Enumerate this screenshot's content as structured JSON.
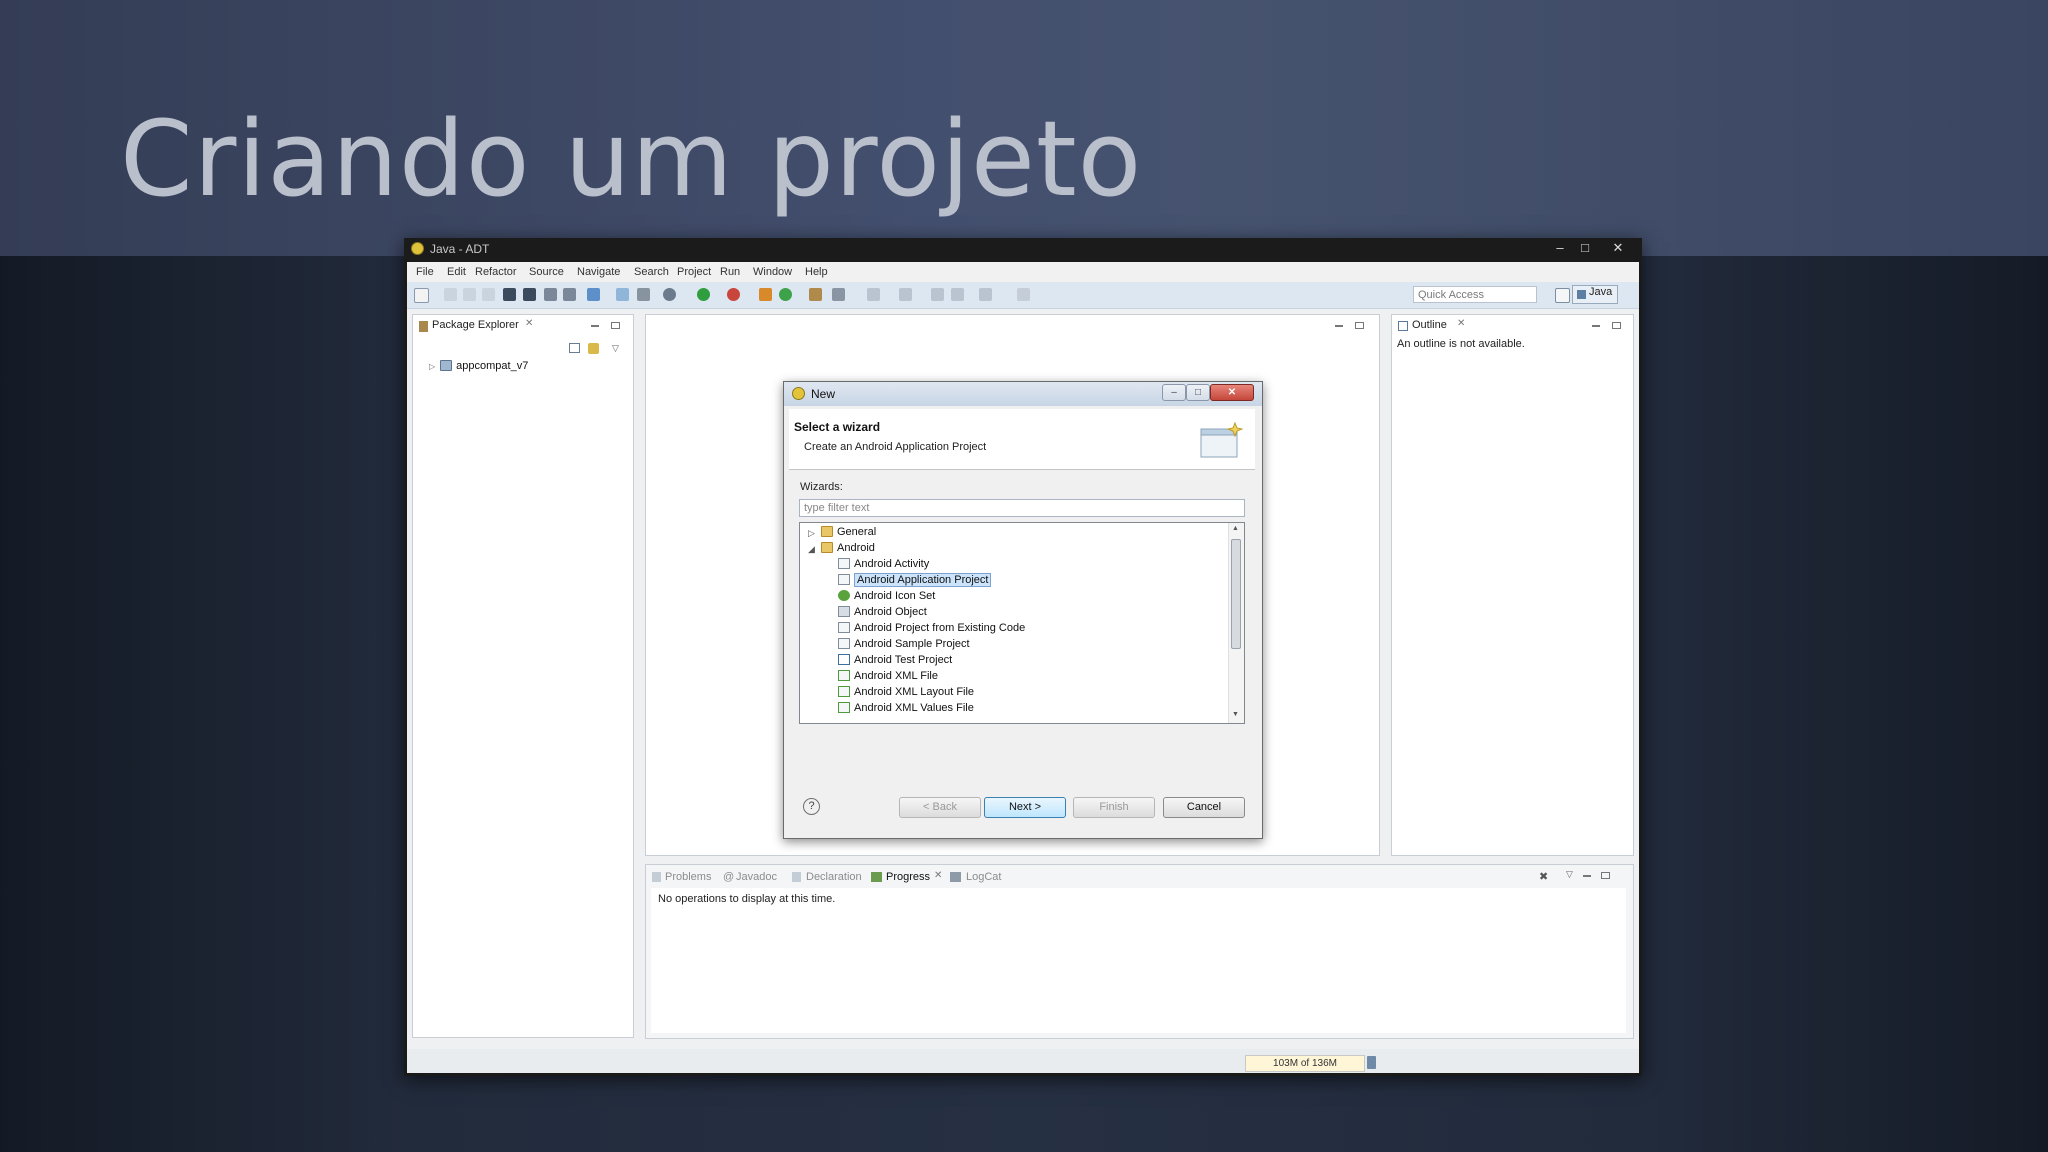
{
  "slide": {
    "title": "Criando um projeto"
  },
  "window": {
    "title": "Java - ADT",
    "controls": {
      "minimize": "–",
      "maximize": "□",
      "close": "✕"
    }
  },
  "menubar": [
    "File",
    "Edit",
    "Refactor",
    "Source",
    "Navigate",
    "Search",
    "Project",
    "Run",
    "Window",
    "Help"
  ],
  "toolbar": {
    "quick_access_placeholder": "Quick Access",
    "perspective": "Java"
  },
  "package_explorer": {
    "tab": "Package Explorer",
    "items": [
      "appcompat_v7"
    ]
  },
  "outline": {
    "tab": "Outline",
    "message": "An outline is not available."
  },
  "bottom_panel": {
    "tabs": [
      "Problems",
      "Javadoc",
      "Declaration",
      "Progress",
      "LogCat"
    ],
    "active_tab": "Progress",
    "message": "No operations to display at this time."
  },
  "status": {
    "heap": "103M of 136M"
  },
  "dialog": {
    "title": "New",
    "heading": "Select a wizard",
    "description": "Create an Android Application Project",
    "wizards_label": "Wizards:",
    "filter_placeholder": "type filter text",
    "tree": {
      "general": "General",
      "android": "Android",
      "android_items": [
        "Android Activity",
        "Android Application Project",
        "Android Icon Set",
        "Android Object",
        "Android Project from Existing Code",
        "Android Sample Project",
        "Android Test Project",
        "Android XML File",
        "Android XML Layout File",
        "Android XML Values File"
      ],
      "selected": "Android Application Project"
    },
    "buttons": {
      "help": "?",
      "back": "< Back",
      "next": "Next >",
      "finish": "Finish",
      "cancel": "Cancel"
    }
  },
  "colors": {
    "selection": "#cce4fb",
    "toolbar": "#dde7f2",
    "slide_title": "#b9bfcb"
  }
}
